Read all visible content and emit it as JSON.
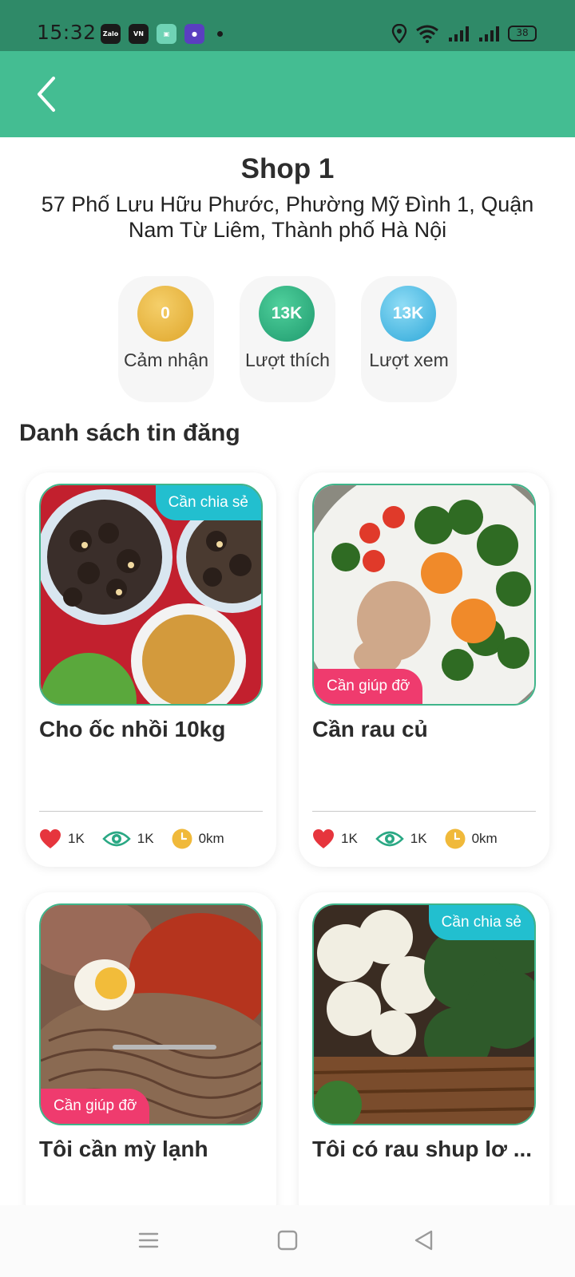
{
  "status_bar": {
    "time": "15:32",
    "battery": "38"
  },
  "shop": {
    "name": "Shop 1",
    "address": "57 Phố Lưu Hữu Phước, Phường Mỹ Đình 1, Quận Nam Từ Liêm, Thành phố Hà Nội"
  },
  "stats": [
    {
      "value": "0",
      "label": "Cảm nhận"
    },
    {
      "value": "13K",
      "label": "Lượt thích"
    },
    {
      "value": "13K",
      "label": "Lượt xem"
    }
  ],
  "section_title": "Danh sách tin đăng",
  "posts": [
    {
      "title": "Cho ốc nhồi 10kg",
      "badge": "Cần chia sẻ",
      "likes": "1K",
      "views": "1K",
      "distance": "0km"
    },
    {
      "title": "Cần rau củ",
      "badge": "Cần giúp đỡ",
      "likes": "1K",
      "views": "1K",
      "distance": "0km"
    },
    {
      "title": "Tôi cần mỳ lạnh",
      "badge": "Cần giúp đỡ"
    },
    {
      "title": "Tôi có rau shup lơ ...",
      "badge": "Cần chia sẻ"
    }
  ],
  "colors": {
    "header": "#44bd92",
    "badge_share": "#22bfcf",
    "badge_help": "#ef3b6e"
  }
}
